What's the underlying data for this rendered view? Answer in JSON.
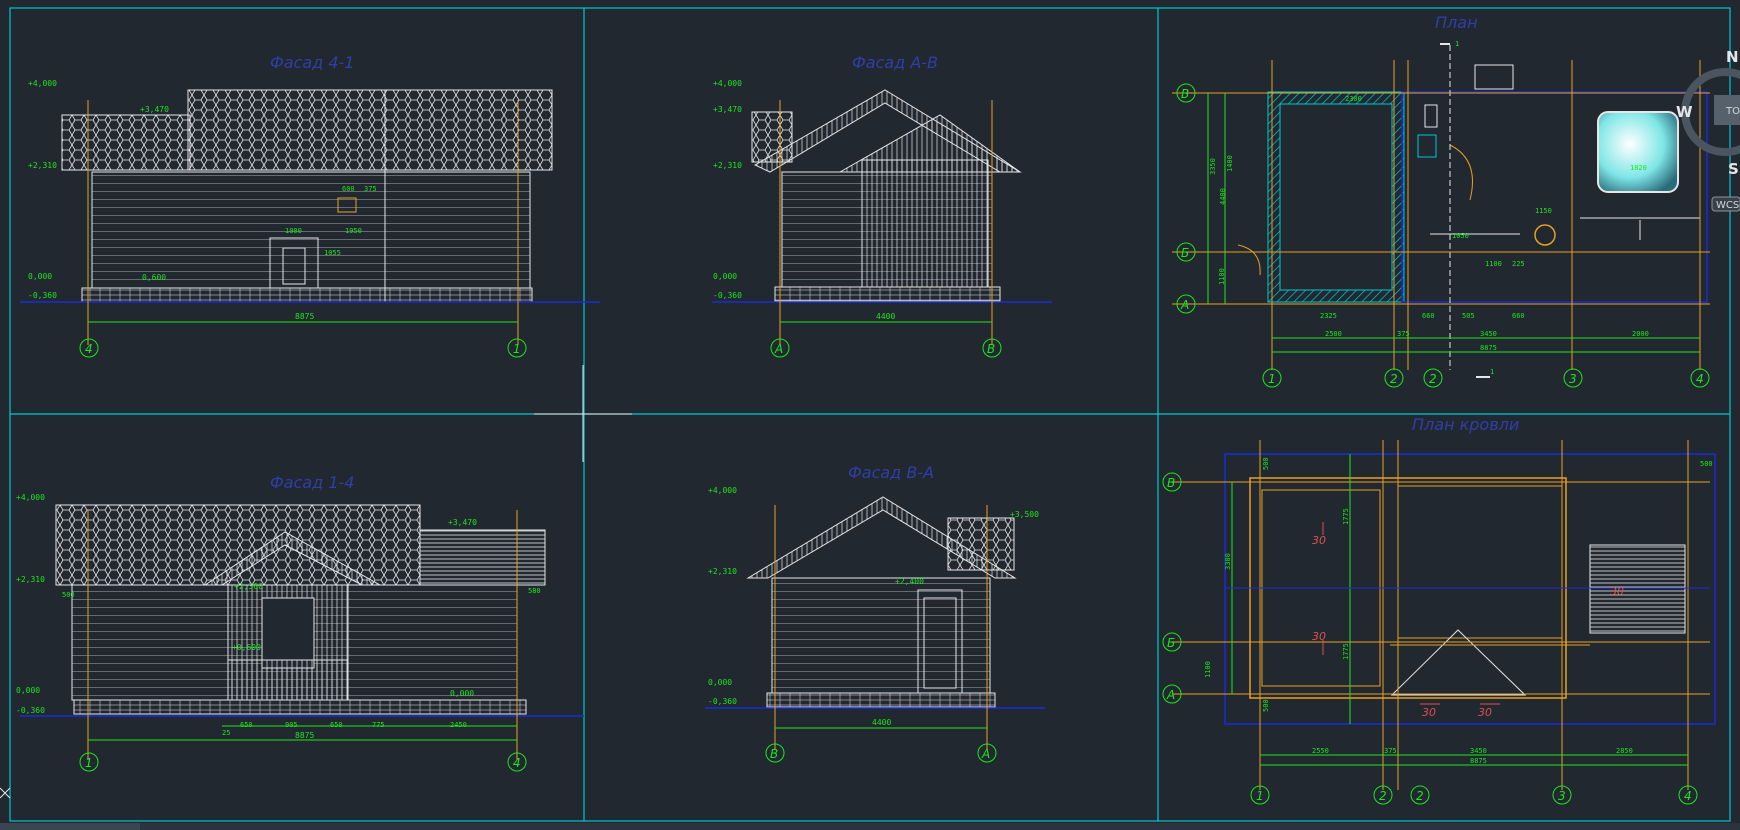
{
  "panels": {
    "facade_4_1": {
      "title": "Фасад 4-1",
      "levels": [
        "+4,000",
        "+3,470",
        "+2,310",
        "0,000",
        "-0,360",
        "0,600"
      ],
      "dims": [
        "600",
        "375",
        "1000",
        "1950",
        "1055",
        "8875"
      ],
      "axes": [
        "4",
        "1"
      ]
    },
    "facade_a_v": {
      "title": "Фасад А-В",
      "levels": [
        "+4,000",
        "+3,470",
        "+2,310",
        "0,000",
        "-0,360"
      ],
      "dims": [
        "4400"
      ],
      "axes": [
        "А",
        "В"
      ]
    },
    "plan": {
      "title": "План",
      "section": "1",
      "axes_v": [
        "В",
        "Б",
        "А"
      ],
      "axes_h": [
        "1",
        "2",
        "2",
        "3",
        "4"
      ],
      "dims": [
        "2300",
        "3350",
        "2500",
        "375",
        "3450",
        "2000",
        "8875",
        "2325",
        "660",
        "505",
        "660",
        "1150",
        "1050",
        "1100",
        "225",
        "4400",
        "1400",
        "1100",
        "1820"
      ]
    },
    "facade_1_4": {
      "title": "Фасад 1-4",
      "levels": [
        "+4,000",
        "+3,470",
        "+2,310",
        "+2,360",
        "0,000",
        "-0,360",
        "+0,600",
        "0,000"
      ],
      "dims": [
        "500",
        "580",
        "25",
        "650",
        "905",
        "650",
        "775",
        "2450",
        "8875"
      ],
      "axes": [
        "1",
        "4"
      ]
    },
    "facade_v_a": {
      "title": "Фасад В-А",
      "levels": [
        "+4,000",
        "+3,500",
        "+2,310",
        "+2,400",
        "0,000",
        "-0,360"
      ],
      "dims": [
        "4400"
      ],
      "axes": [
        "В",
        "А"
      ]
    },
    "roof_plan": {
      "title": "План кровли",
      "axes_v": [
        "В",
        "Б",
        "А"
      ],
      "axes_h": [
        "1",
        "2",
        "2",
        "3",
        "4"
      ],
      "slopes": [
        "30",
        "30",
        "30",
        "30",
        "30"
      ],
      "dims": [
        "500",
        "500",
        "1775",
        "3300",
        "1775",
        "1100",
        "2550",
        "3450",
        "2850",
        "8875",
        "375",
        "500"
      ]
    }
  },
  "viewcube": {
    "top": "ТОП",
    "west": "W",
    "south": "S",
    "north": "N",
    "wcs": "WCS"
  },
  "colors": {
    "background": "#212830",
    "frame": "#00c8d2",
    "wall": "#e6e6e6",
    "dim": "#1ee61e",
    "axis": "#e8a020",
    "title": "#2f3fa8",
    "ground": "#1a2bd6"
  }
}
